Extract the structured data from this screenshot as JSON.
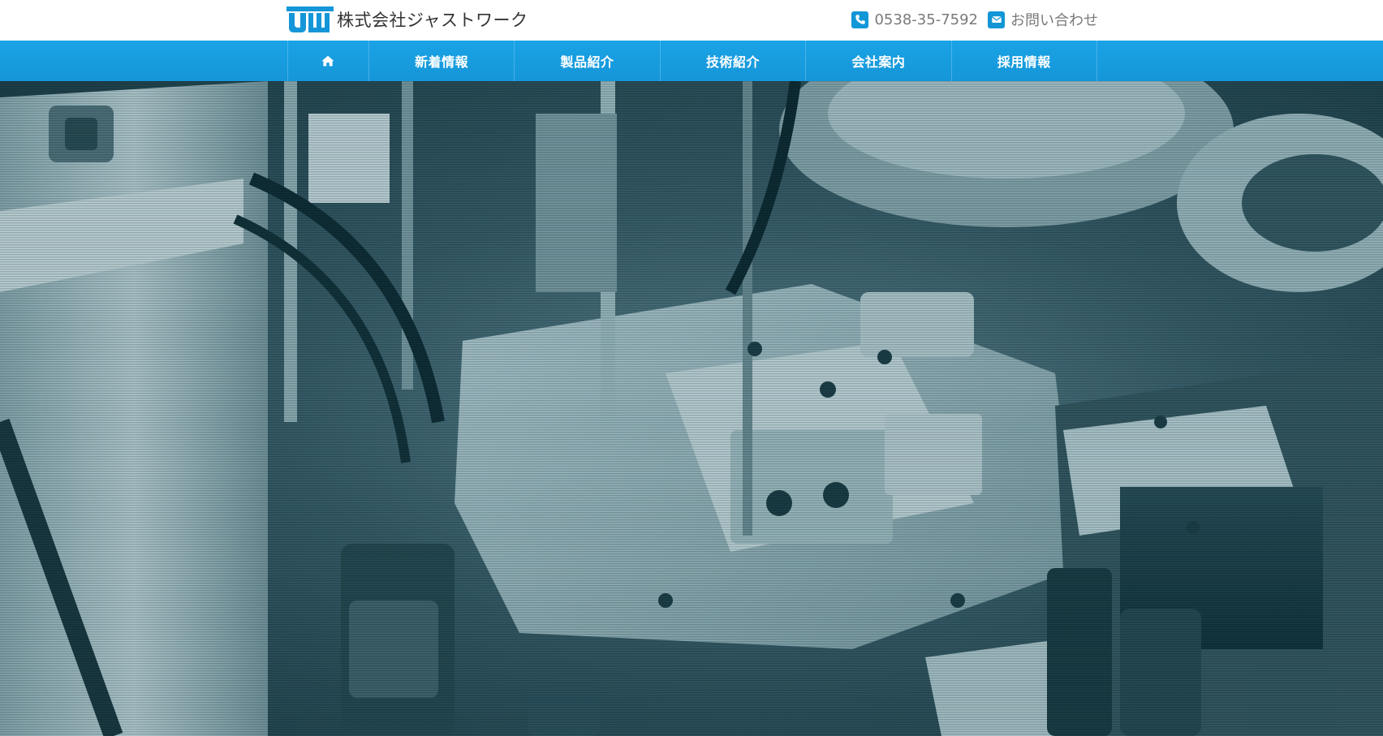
{
  "header": {
    "logo_mark": "JW",
    "company_name": "株式会社ジャストワーク",
    "phone": "0538-35-7592",
    "contact_label": "お問い合わせ",
    "icons": {
      "phone": "phone-icon",
      "mail": "envelope-icon"
    }
  },
  "nav": {
    "home_icon": "home-icon",
    "items": [
      {
        "label": "新着情報"
      },
      {
        "label": "製品紹介"
      },
      {
        "label": "技術紹介"
      },
      {
        "label": "会社案内"
      },
      {
        "label": "採用情報"
      }
    ]
  },
  "hero": {
    "image": "factory-machinery-photo"
  },
  "colors": {
    "brand_blue": "#1596d8",
    "text_gray": "#7a7a7a"
  }
}
